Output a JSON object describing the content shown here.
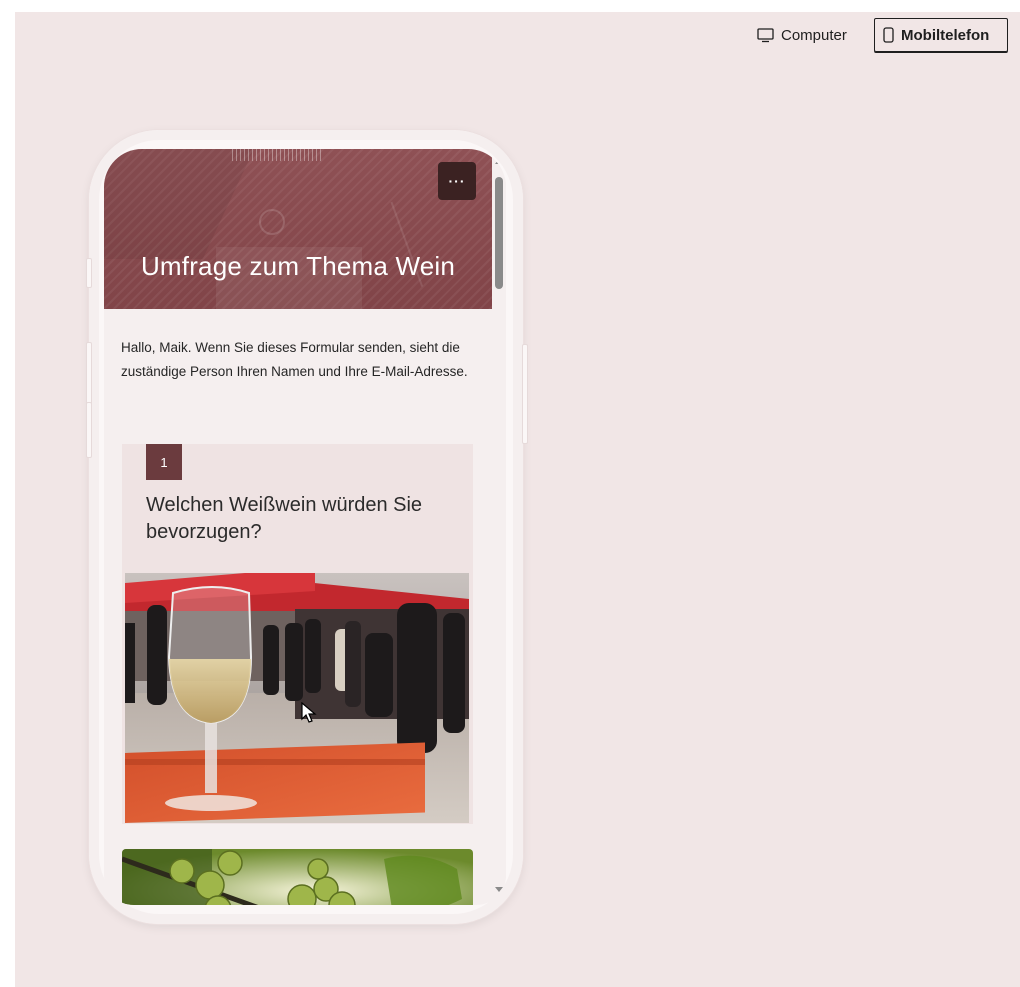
{
  "toolbar": {
    "computer_label": "Computer",
    "mobile_label": "Mobiltelefon",
    "computer_icon": "monitor-icon",
    "mobile_icon": "phone-icon",
    "selected": "Mobiltelefon"
  },
  "form": {
    "title": "Umfrage zum Thema Wein",
    "more_label": "···",
    "intro": "Hallo, Maik. Wenn Sie dieses Formular senden, sieht die zuständige Person Ihren Namen und Ihre E-Mail-Adresse.",
    "questions": [
      {
        "number": "1",
        "text": "Welchen Weißwein würden Sie bevorzugen?"
      }
    ]
  },
  "colors": {
    "background": "#f1e6e6",
    "banner": "#8a4b4f",
    "accent": "#6b3b3e",
    "card": "#efe3e3"
  }
}
